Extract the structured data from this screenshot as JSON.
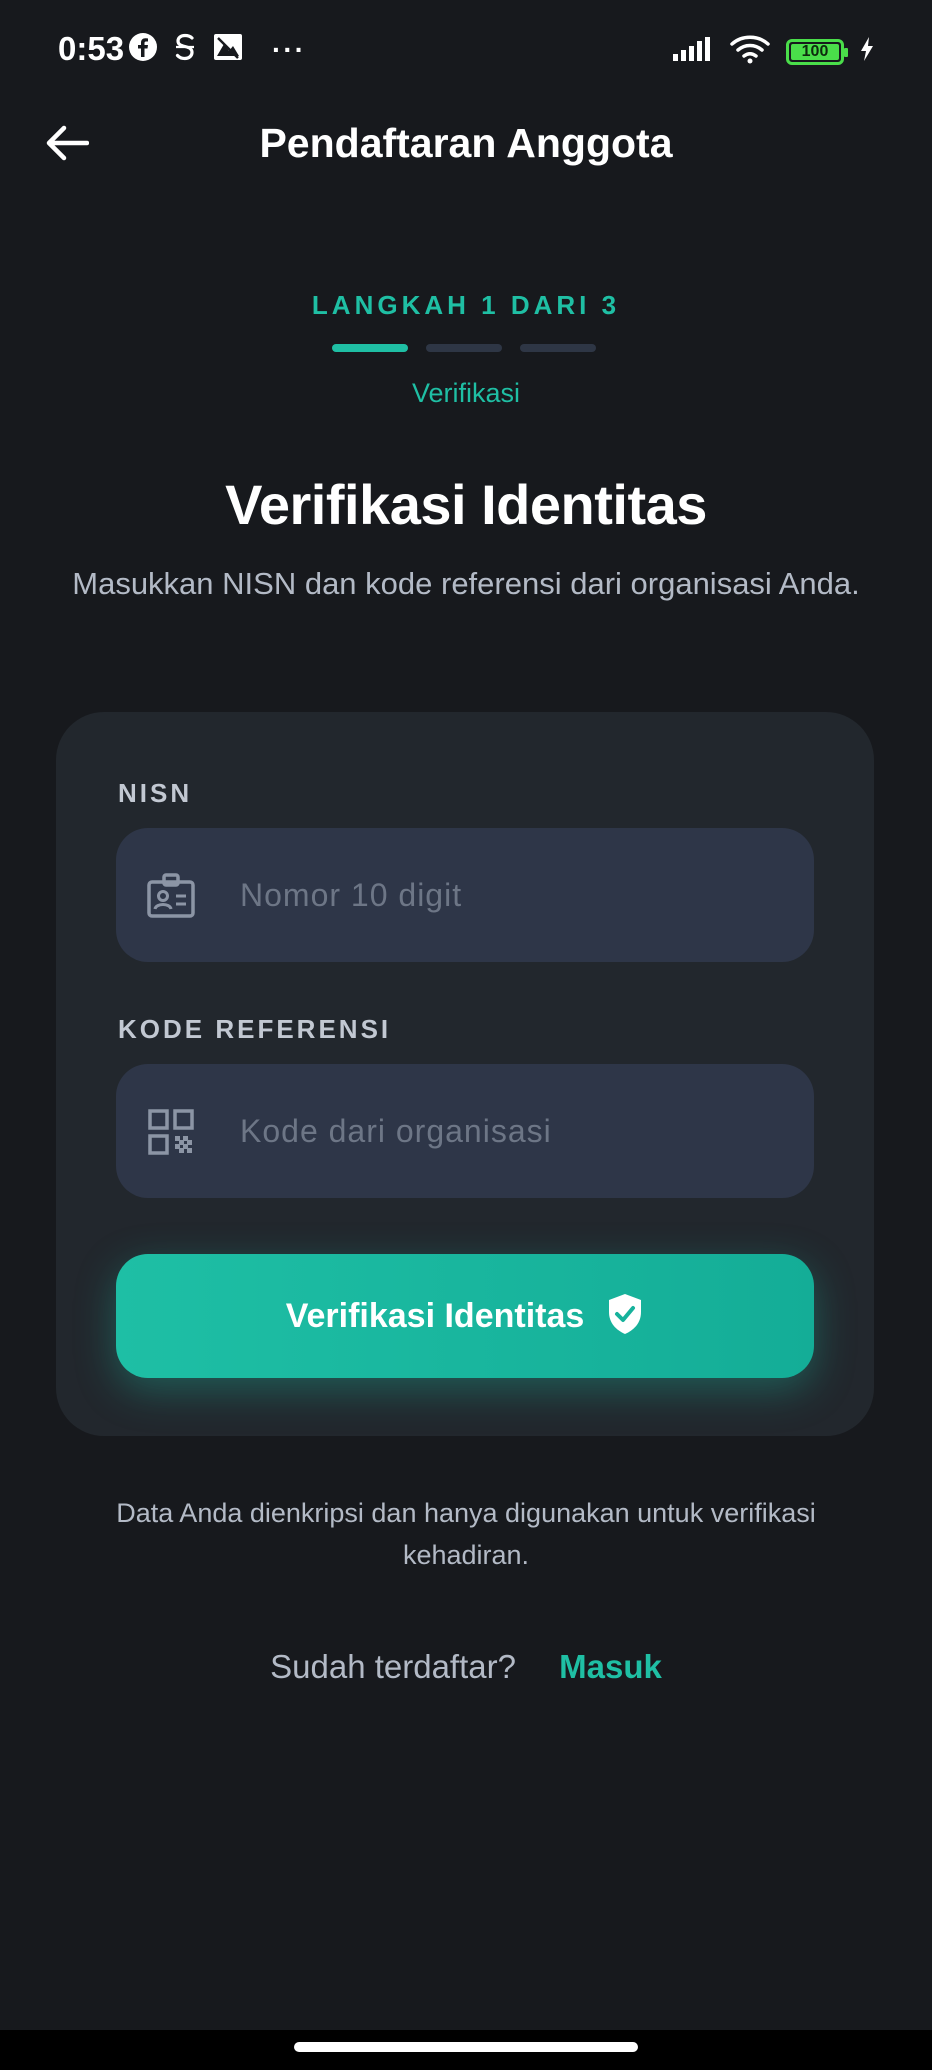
{
  "status_bar": {
    "time": "0:53",
    "more": "···",
    "battery": "100"
  },
  "header": {
    "title": "Pendaftaran Anggota"
  },
  "stepper": {
    "label": "LANGKAH 1 DARI 3",
    "current_step": 1,
    "total_steps": 3,
    "step_name": "Verifikasi"
  },
  "page": {
    "title": "Verifikasi Identitas",
    "subtitle": "Masukkan NISN dan kode referensi dari organisasi Anda."
  },
  "form": {
    "nisn": {
      "label": "NISN",
      "value": "",
      "placeholder": "Nomor 10 digit",
      "icon": "id-card-icon"
    },
    "referral": {
      "label": "KODE REFERENSI",
      "value": "",
      "placeholder": "Kode dari organisasi",
      "icon": "qr-code-icon"
    },
    "submit_label": "Verifikasi Identitas",
    "submit_icon": "shield-check-icon"
  },
  "privacy_note": "Data Anda dienkripsi dan hanya digunakan untuk verifikasi kehadiran.",
  "login": {
    "question": "Sudah terdaftar?",
    "link_label": "Masuk"
  },
  "colors": {
    "background": "#17191d",
    "card": "#22272d",
    "input": "#2e3648",
    "accent": "#1fbfa4",
    "muted_text": "#b3bac6",
    "placeholder": "#6d7686"
  }
}
